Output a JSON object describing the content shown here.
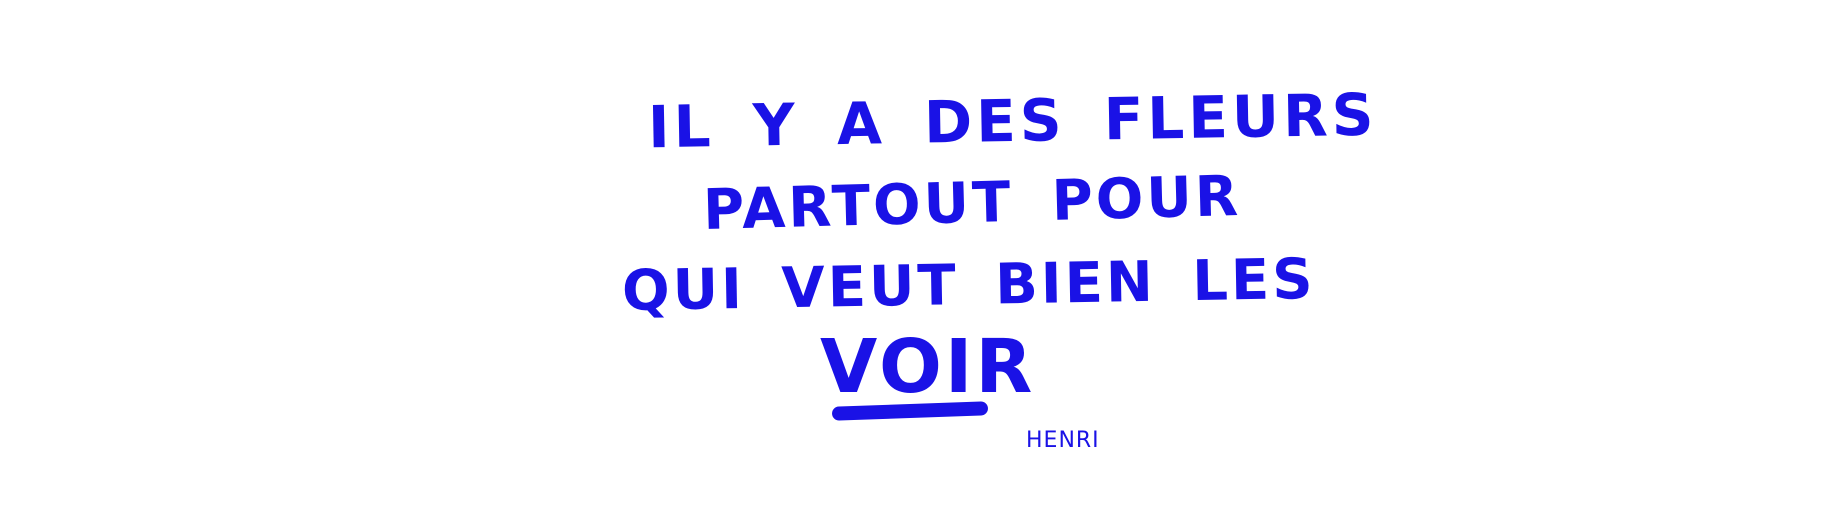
{
  "quote": {
    "line1": "IL Y A DES FLEURS",
    "line2": "PARTOUT POUR",
    "line3": "QUI VEUT BIEN LES",
    "line4": "VOIR"
  },
  "signature": "HENRI",
  "colors": {
    "ink": "#1a12e6",
    "background": "#ffffff"
  }
}
